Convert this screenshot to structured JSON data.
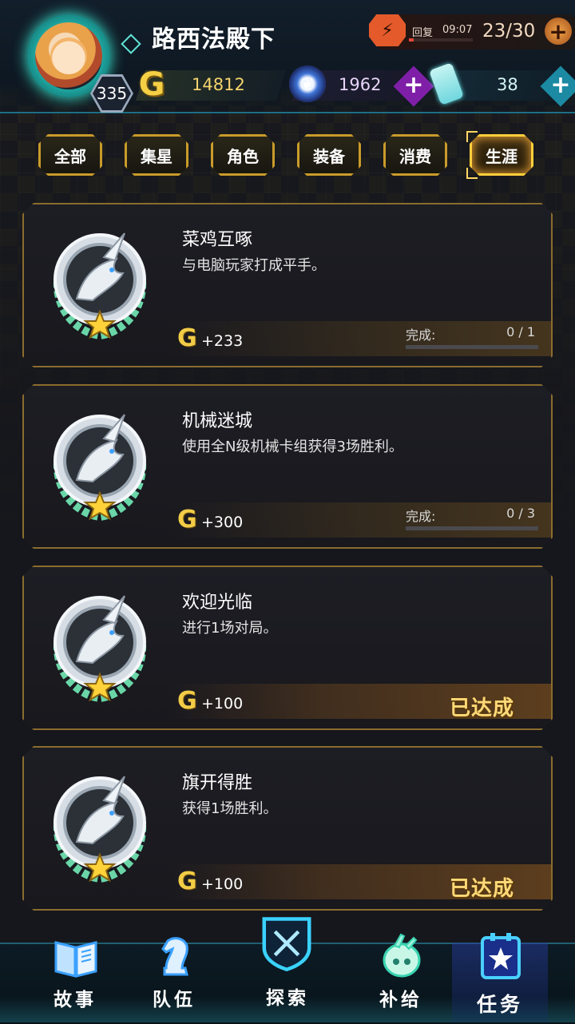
{
  "player": {
    "name": "路西法殿下",
    "level": "335"
  },
  "stamina": {
    "label": "回复",
    "timer": "09:07",
    "value": "23/30",
    "fill_fraction": 0.07
  },
  "currencies": {
    "gold": {
      "symbol": "G",
      "value": "14812"
    },
    "gems": {
      "value": "1962"
    },
    "tickets": {
      "value": "38"
    }
  },
  "tabs": [
    {
      "label": "全部",
      "active": false
    },
    {
      "label": "集星",
      "active": false
    },
    {
      "label": "角色",
      "active": false
    },
    {
      "label": "装备",
      "active": false
    },
    {
      "label": "消费",
      "active": false
    },
    {
      "label": "生涯",
      "active": true
    }
  ],
  "missions": [
    {
      "title": "菜鸡互啄",
      "description": "与电脑玩家打成平手。",
      "reward_symbol": "G",
      "reward": "+233",
      "progress_label": "完成:",
      "progress": "0 / 1",
      "progress_fraction": 0,
      "completed": false
    },
    {
      "title": "机械迷城",
      "description": "使用全N级机械卡组获得3场胜利。",
      "reward_symbol": "G",
      "reward": "+300",
      "progress_label": "完成:",
      "progress": "0 / 3",
      "progress_fraction": 0,
      "completed": false
    },
    {
      "title": "欢迎光临",
      "description": "进行1场对局。",
      "reward_symbol": "G",
      "reward": "+100",
      "completed": true,
      "status": "已达成"
    },
    {
      "title": "旗开得胜",
      "description": "获得1场胜利。",
      "reward_symbol": "G",
      "reward": "+100",
      "completed": true,
      "status": "已达成"
    }
  ],
  "nav": [
    {
      "label": "故事",
      "icon": "book-icon",
      "active": false
    },
    {
      "label": "队伍",
      "icon": "chess-knight-icon",
      "active": false
    },
    {
      "label": "探索",
      "icon": "crossed-swords-shield-icon",
      "active": false
    },
    {
      "label": "补给",
      "icon": "supply-capsule-icon",
      "active": false
    },
    {
      "label": "任务",
      "icon": "star-clipboard-icon",
      "active": true
    }
  ],
  "colors": {
    "accent_gold": "#c99b2a",
    "accent_cyan": "#3cf2d9",
    "gold_text": "#f4d36c",
    "completed_text": "#ffd977"
  }
}
